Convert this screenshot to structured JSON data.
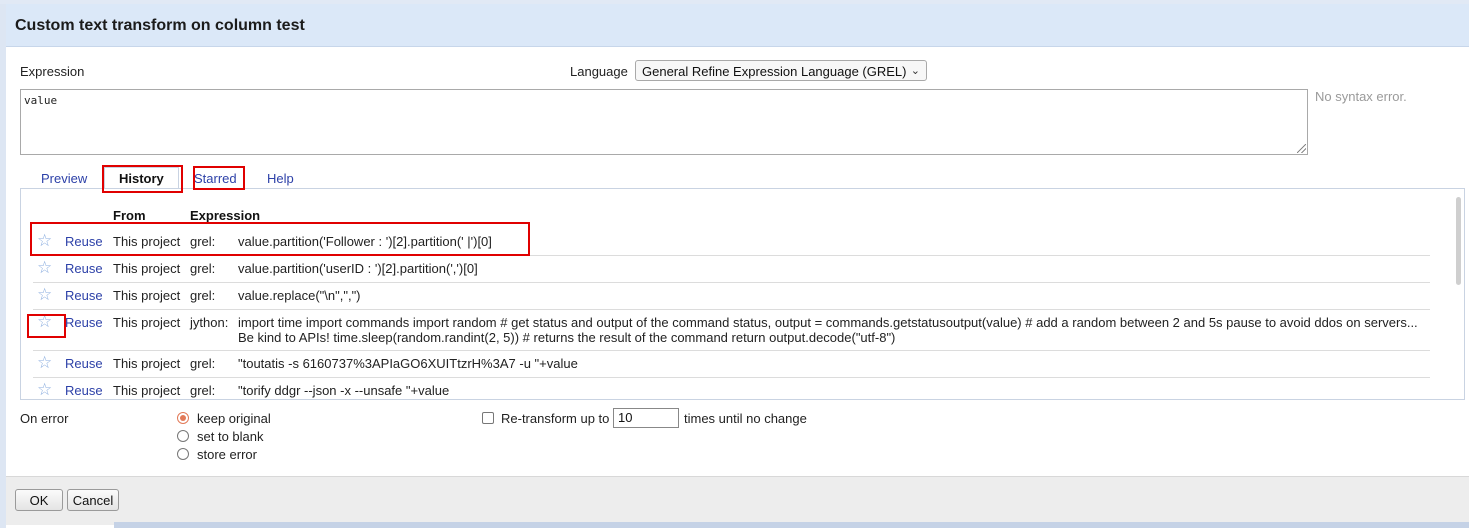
{
  "dialog": {
    "title": "Custom text transform on column test",
    "expression_label": "Expression",
    "language_label": "Language",
    "language_value": "General Refine Expression Language (GREL)",
    "expression_value": "value",
    "syntax_status": "No syntax error."
  },
  "tabs": [
    {
      "label": "Preview",
      "active": false
    },
    {
      "label": "History",
      "active": true
    },
    {
      "label": "Starred",
      "active": false
    },
    {
      "label": "Help",
      "active": false
    }
  ],
  "history": {
    "headers": {
      "from": "From",
      "expression": "Expression"
    },
    "reuse_label": "Reuse",
    "rows": [
      {
        "from": "This project",
        "lang": "grel:",
        "expr": "value.partition('Follower : ')[2].partition(' |')[0]"
      },
      {
        "from": "This project",
        "lang": "grel:",
        "expr": "value.partition('userID : ')[2].partition(',')[0]"
      },
      {
        "from": "This project",
        "lang": "grel:",
        "expr": "value.replace(\"\\n\",\",\")"
      },
      {
        "from": "This project",
        "lang": "jython:",
        "expr": "import time import commands import random # get status and output of the command status, output = commands.getstatusoutput(value) # add a random between 2 and 5s pause to avoid ddos on servers... Be kind to APIs! time.sleep(random.randint(2, 5)) # returns the result of the command return output.decode(\"utf-8\")"
      },
      {
        "from": "This project",
        "lang": "grel:",
        "expr": "\"toutatis -s 6160737%3APIaGO6XUITtzrH%3A7 -u \"+value"
      },
      {
        "from": "This project",
        "lang": "grel:",
        "expr": "\"torify ddgr --json -x --unsafe \"+value"
      }
    ]
  },
  "on_error": {
    "label": "On error",
    "options": [
      {
        "label": "keep original",
        "checked": true
      },
      {
        "label": "set to blank",
        "checked": false
      },
      {
        "label": "store error",
        "checked": false
      }
    ]
  },
  "retransform": {
    "label_before": "Re-transform up to",
    "value": "10",
    "label_after": "times until no change"
  },
  "buttons": {
    "ok": "OK",
    "cancel": "Cancel"
  }
}
